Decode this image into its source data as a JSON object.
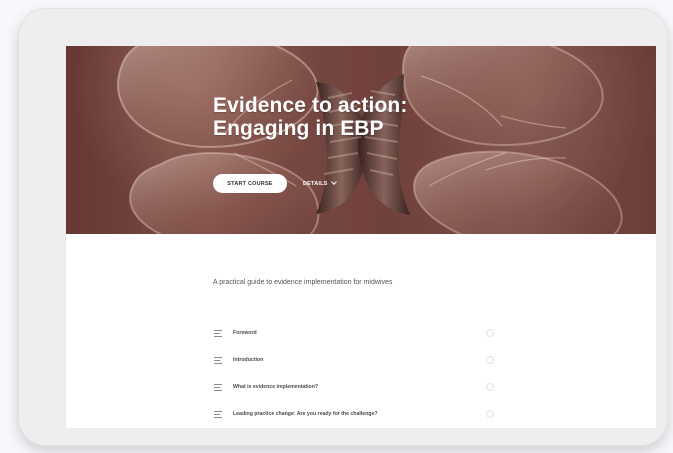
{
  "colors": {
    "hero_overlay": "#7c4c46",
    "page_background": "#f7f7fc",
    "device_frame": "#eeeeee",
    "text_dark": "#4c4c4c",
    "text_white": "#ffffff"
  },
  "hero": {
    "title_line_1": "Evidence to action:",
    "title_line_2": "Engaging in EBP",
    "start_button_label": "START COURSE",
    "details_label": "DETAILS",
    "background_image": "light-bulbs-image"
  },
  "content": {
    "subtitle": "A practical guide to evidence implementation for midwives",
    "lessons": [
      {
        "title": "Foreword",
        "icon": "lesson-lines-icon"
      },
      {
        "title": "Introduction",
        "icon": "lesson-lines-icon"
      },
      {
        "title": "What is evidence implementation?",
        "icon": "lesson-lines-icon"
      },
      {
        "title": "Leading practice change: Are you ready for the challenge?",
        "icon": "lesson-lines-icon"
      }
    ]
  }
}
